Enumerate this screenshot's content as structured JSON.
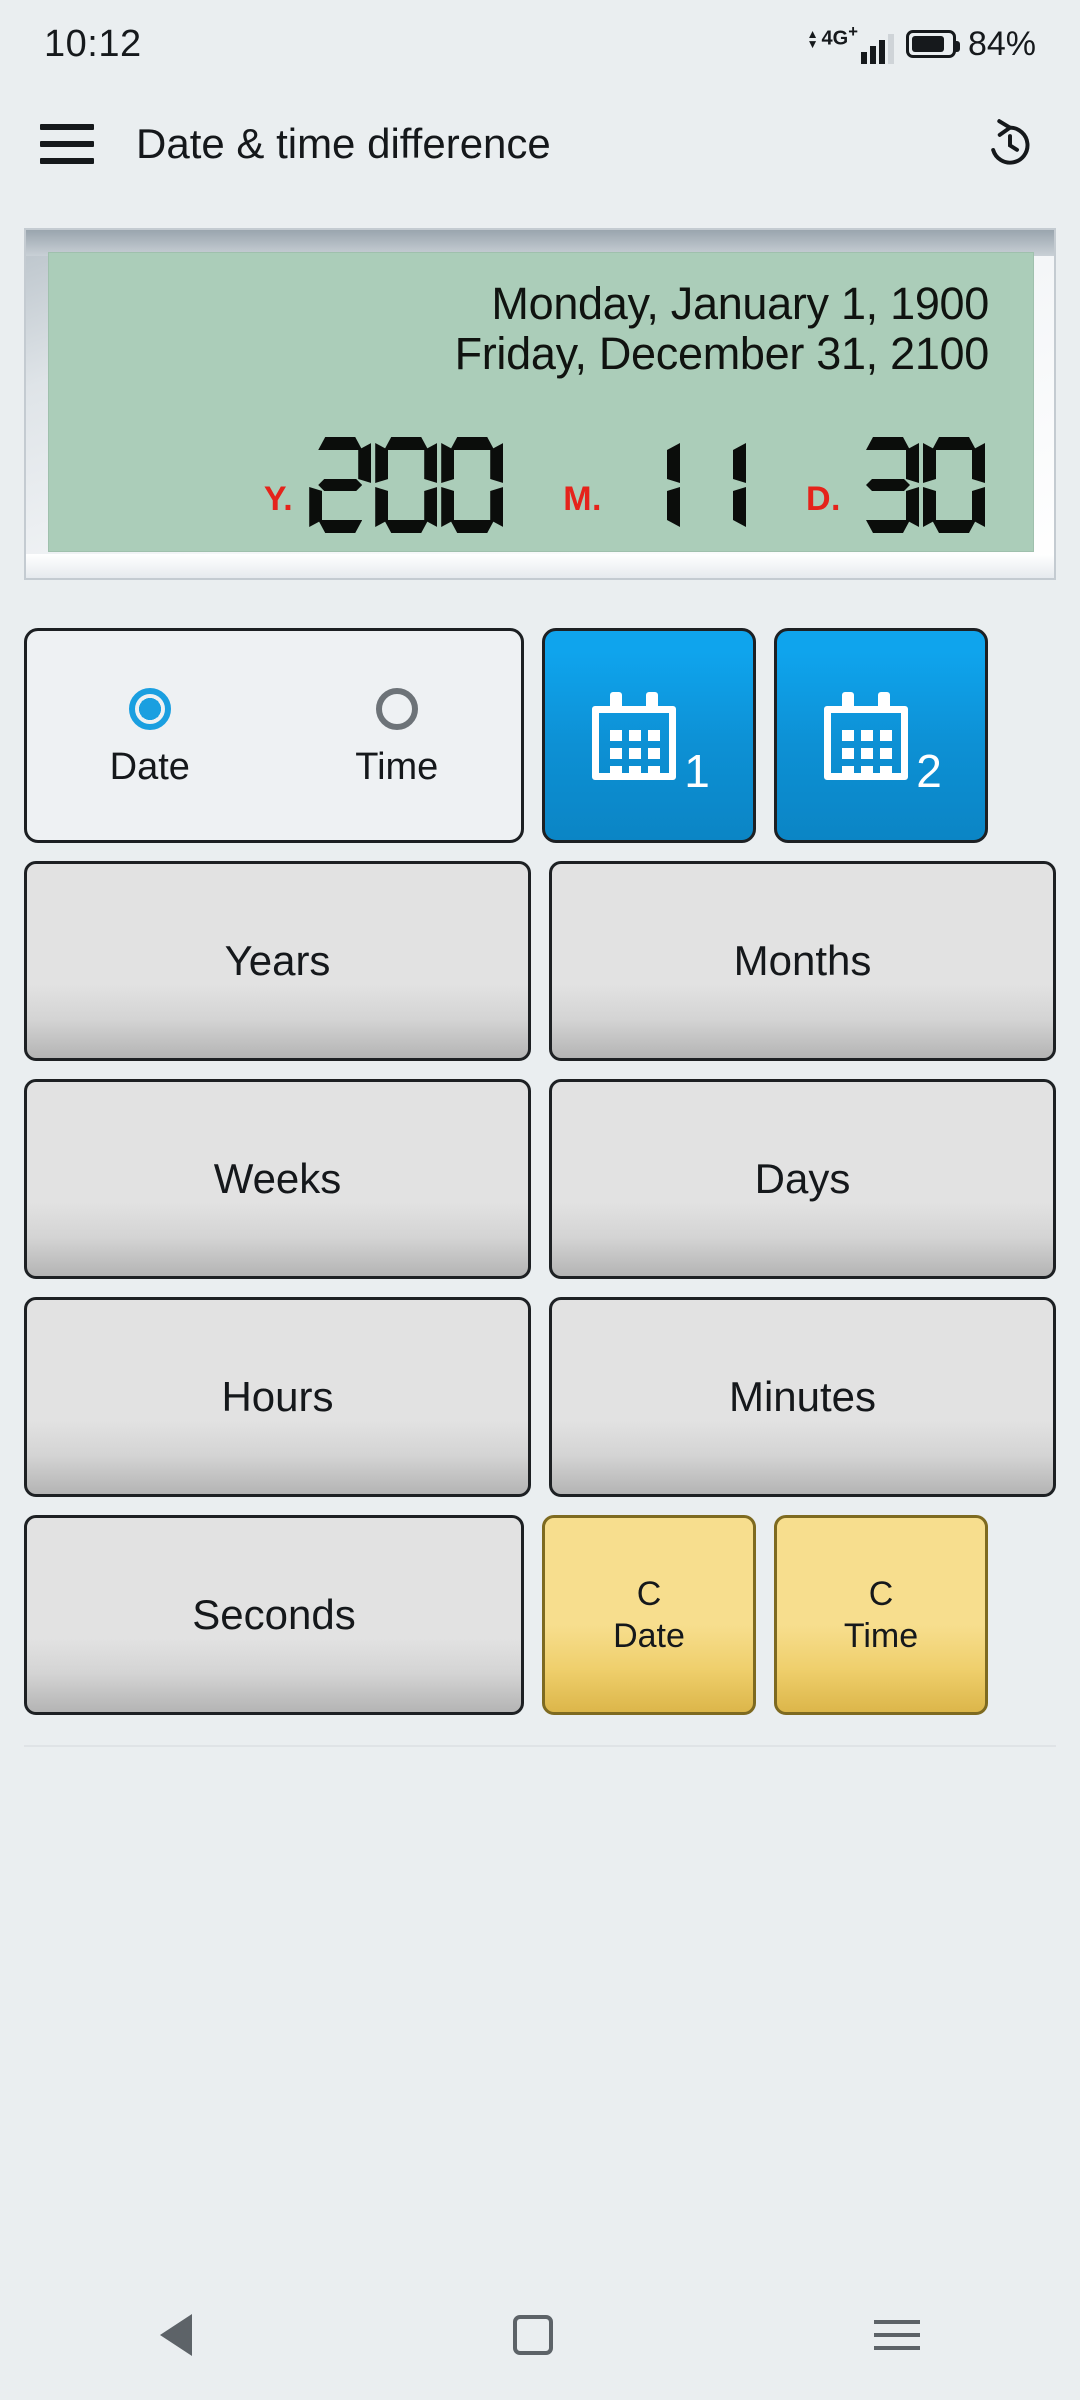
{
  "statusbar": {
    "time": "10:12",
    "network_label": "4G",
    "network_plus": "+",
    "battery_percent": "84%",
    "signal_icon": "signal-bars-icon",
    "battery_icon": "battery-icon"
  },
  "appbar": {
    "menu_icon": "hamburger-menu-icon",
    "title": "Date & time difference",
    "history_icon": "history-clock-icon"
  },
  "display": {
    "date_from": "Monday, January 1, 1900",
    "date_to": "Friday, December 31, 2100",
    "segments": [
      {
        "label": "Y.",
        "value": "200"
      },
      {
        "label": "M.",
        "value": "11"
      },
      {
        "label": "D.",
        "value": "30"
      }
    ],
    "lcd_background": "#abcdb9",
    "label_color": "#e5231b",
    "digit_color": "#0b0d0b"
  },
  "mode_selector": {
    "options": [
      {
        "label": "Date",
        "selected": true
      },
      {
        "label": "Time",
        "selected": false
      }
    ],
    "accent_color": "#1a9fe0"
  },
  "date_pickers": [
    {
      "icon": "calendar-icon",
      "number": "1"
    },
    {
      "icon": "calendar-icon",
      "number": "2"
    }
  ],
  "unit_buttons": [
    "Years",
    "Months",
    "Weeks",
    "Days",
    "Hours",
    "Minutes",
    "Seconds"
  ],
  "clear_buttons": [
    {
      "line1": "C",
      "line2": "Date"
    },
    {
      "line1": "C",
      "line2": "Time"
    }
  ],
  "colors": {
    "page_background": "#eaeef0",
    "picker_blue": "#0d90d4",
    "clear_yellow": "#efcf6c",
    "unit_gray": "#e2e2e2"
  },
  "navbar": {
    "back_icon": "back-triangle-icon",
    "home_icon": "home-square-icon",
    "recents_icon": "recents-lines-icon"
  }
}
